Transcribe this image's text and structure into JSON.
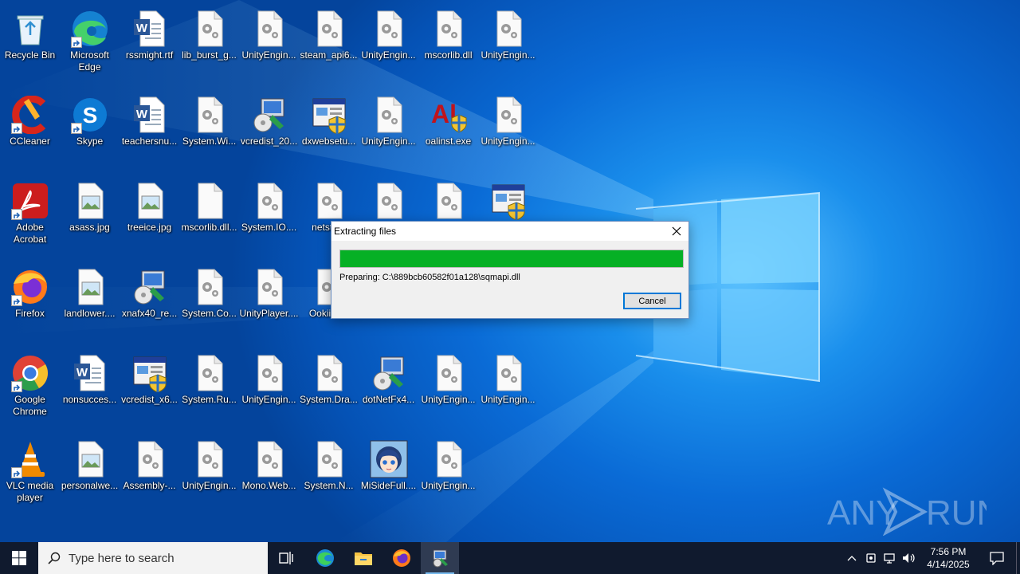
{
  "desktop": {
    "icons": [
      {
        "label": "Recycle Bin",
        "kind": "recycle-bin",
        "shortcut": false
      },
      {
        "label": "Microsoft Edge",
        "kind": "edge",
        "shortcut": true
      },
      {
        "label": "rssmight.rtf",
        "kind": "word-doc",
        "shortcut": false
      },
      {
        "label": "lib_burst_g...",
        "kind": "gear-file",
        "shortcut": false
      },
      {
        "label": "UnityEngin...",
        "kind": "gear-file",
        "shortcut": false
      },
      {
        "label": "steam_api6...",
        "kind": "gear-file",
        "shortcut": false
      },
      {
        "label": "UnityEngin...",
        "kind": "gear-file",
        "shortcut": false
      },
      {
        "label": "mscorlib.dll",
        "kind": "gear-file",
        "shortcut": false
      },
      {
        "label": "UnityEngin...",
        "kind": "gear-file",
        "shortcut": false
      },
      {
        "label": "CCleaner",
        "kind": "ccleaner",
        "shortcut": true
      },
      {
        "label": "Skype",
        "kind": "skype",
        "shortcut": true
      },
      {
        "label": "teachersnu...",
        "kind": "word-doc",
        "shortcut": false
      },
      {
        "label": "System.Wi...",
        "kind": "gear-file",
        "shortcut": false
      },
      {
        "label": "vcredist_20...",
        "kind": "installer",
        "shortcut": false
      },
      {
        "label": "dxwebsetu...",
        "kind": "setup-window",
        "shortcut": false
      },
      {
        "label": "UnityEngin...",
        "kind": "gear-file",
        "shortcut": false
      },
      {
        "label": "oalinst.exe",
        "kind": "al-shield",
        "shortcut": false
      },
      {
        "label": "UnityEngin...",
        "kind": "gear-file",
        "shortcut": false
      },
      {
        "label": "Adobe Acrobat",
        "kind": "acrobat",
        "shortcut": true
      },
      {
        "label": "asass.jpg",
        "kind": "image-file",
        "shortcut": false
      },
      {
        "label": "treeice.jpg",
        "kind": "image-file",
        "shortcut": false
      },
      {
        "label": "mscorlib.dll...",
        "kind": "blank-file",
        "shortcut": false
      },
      {
        "label": "System.IO....",
        "kind": "gear-file",
        "shortcut": false
      },
      {
        "label": "netsta...",
        "kind": "gear-file",
        "shortcut": false
      },
      {
        "label": "",
        "kind": "gear-file",
        "shortcut": false
      },
      {
        "label": "",
        "kind": "gear-file",
        "shortcut": false
      },
      {
        "label": "",
        "kind": "setup-window",
        "shortcut": false
      },
      {
        "label": "Firefox",
        "kind": "firefox",
        "shortcut": true
      },
      {
        "label": "landlower....",
        "kind": "image-file",
        "shortcut": false
      },
      {
        "label": "xnafx40_re...",
        "kind": "installer",
        "shortcut": false
      },
      {
        "label": "System.Co...",
        "kind": "gear-file",
        "shortcut": false
      },
      {
        "label": "UnityPlayer....",
        "kind": "gear-file",
        "shortcut": false
      },
      {
        "label": "Ookii.D...",
        "kind": "gear-file",
        "shortcut": false
      },
      {
        "label": "Google Chrome",
        "kind": "chrome",
        "shortcut": true
      },
      {
        "label": "nonsucces...",
        "kind": "word-doc",
        "shortcut": false
      },
      {
        "label": "vcredist_x6...",
        "kind": "setup-window",
        "shortcut": false
      },
      {
        "label": "System.Ru...",
        "kind": "gear-file",
        "shortcut": false
      },
      {
        "label": "UnityEngin...",
        "kind": "gear-file",
        "shortcut": false
      },
      {
        "label": "System.Dra...",
        "kind": "gear-file",
        "shortcut": false
      },
      {
        "label": "dotNetFx4...",
        "kind": "installer",
        "shortcut": false
      },
      {
        "label": "UnityEngin...",
        "kind": "gear-file",
        "shortcut": false
      },
      {
        "label": "UnityEngin...",
        "kind": "gear-file",
        "shortcut": false
      },
      {
        "label": "VLC media player",
        "kind": "vlc",
        "shortcut": true
      },
      {
        "label": "personalwe...",
        "kind": "image-file",
        "shortcut": false
      },
      {
        "label": "Assembly-...",
        "kind": "gear-file",
        "shortcut": false
      },
      {
        "label": "UnityEngin...",
        "kind": "gear-file",
        "shortcut": false
      },
      {
        "label": "Mono.Web...",
        "kind": "gear-file",
        "shortcut": false
      },
      {
        "label": "System.N...",
        "kind": "gear-file",
        "shortcut": false
      },
      {
        "label": "MiSideFull....",
        "kind": "anime-avatar",
        "shortcut": false
      },
      {
        "label": "UnityEngin...",
        "kind": "gear-file",
        "shortcut": false
      }
    ]
  },
  "dialog": {
    "title": "Extracting files",
    "progress_fraction": 1.0,
    "status": "Preparing: C:\\889bcb60582f01a128\\sqmapi.dll",
    "cancel_label": "Cancel"
  },
  "taskbar": {
    "search_placeholder": "Type here to search",
    "apps": [
      "task-view-icon",
      "edge-icon",
      "file-explorer-icon",
      "firefox-icon",
      "installer-icon"
    ],
    "time": "7:56 PM",
    "date": "4/14/2025"
  },
  "watermark": {
    "text": "ANY RUN"
  },
  "colors": {
    "progress": "#06b025",
    "taskbar": "#101a2e",
    "accent": "#0078d7"
  }
}
